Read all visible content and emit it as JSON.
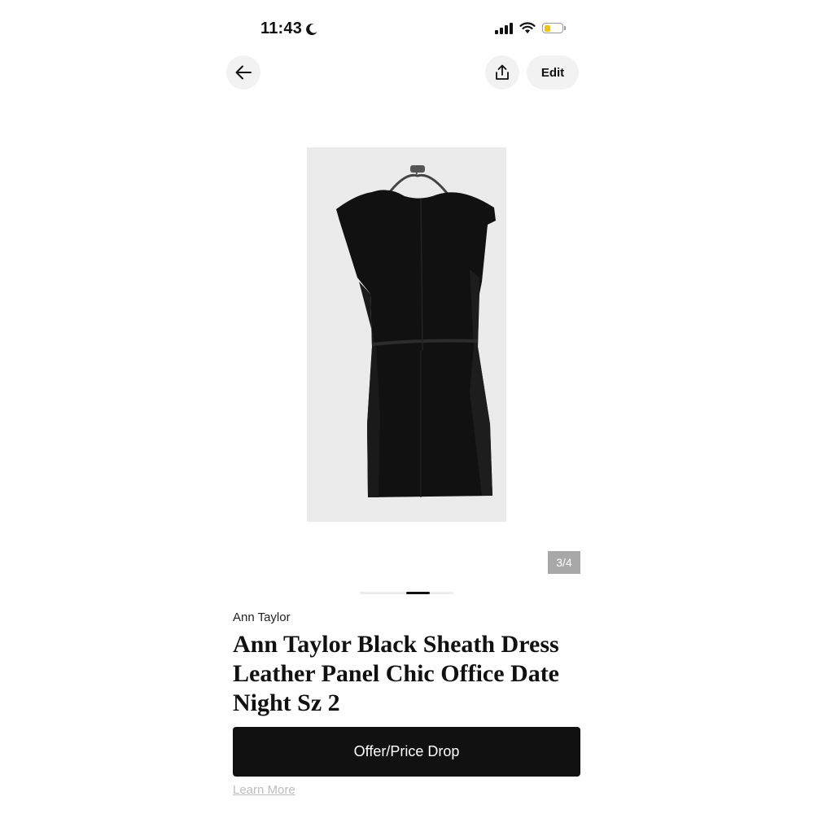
{
  "status_bar": {
    "time": "11:43",
    "battery_level": 0.35,
    "battery_color": "#f2c500",
    "icons": [
      "moon-icon",
      "signal-icon",
      "wifi-icon",
      "battery-icon"
    ]
  },
  "nav": {
    "back_icon": "arrow-left-icon",
    "share_icon": "share-upload-icon",
    "edit_label": "Edit"
  },
  "gallery": {
    "counter": "3/4",
    "current_index": 3,
    "total": 4
  },
  "listing": {
    "brand": "Ann Taylor",
    "title": "Ann Taylor Black Sheath Dress Leather Panel Chic Office Date Night Sz 2"
  },
  "actions": {
    "offer_label": "Offer/Price Drop",
    "learn_more_label": "Learn More"
  },
  "colors": {
    "primary_button": "#111111",
    "chip_background": "#f2f2f2",
    "counter_background": "#a8a8a8"
  }
}
